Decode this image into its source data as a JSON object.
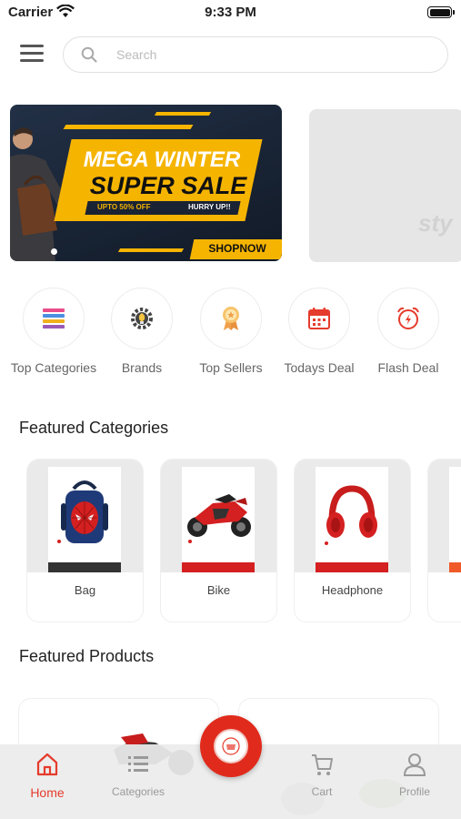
{
  "status_bar": {
    "carrier": "Carrier",
    "time": "9:33 PM"
  },
  "header": {
    "menu_icon": "hamburger-menu-icon",
    "search_icon": "search-icon",
    "search_placeholder": "Search"
  },
  "banner": {
    "line1": "MEGA WINTER",
    "line2": "SUPER SALE",
    "upto": "UPTO 50% OFF",
    "hurry": "HURRY UP!!",
    "cta": "SHOPNOW",
    "second_banner_text": "sty"
  },
  "quick_links": [
    {
      "label": "Top Categories",
      "icon": "stacked-categories-icon"
    },
    {
      "label": "Brands",
      "icon": "gear-brand-icon"
    },
    {
      "label": "Top Sellers",
      "icon": "award-ribbon-icon"
    },
    {
      "label": "Todays Deal",
      "icon": "calendar-icon"
    },
    {
      "label": "Flash Deal",
      "icon": "alarm-clock-icon"
    }
  ],
  "featured_categories": {
    "title": "Featured Categories",
    "items": [
      {
        "name": "Bag",
        "image": "spiderman-backpack-image",
        "bar_color": "#333333"
      },
      {
        "name": "Bike",
        "image": "red-motorcycle-image",
        "bar_color": "#d42020"
      },
      {
        "name": "Headphone",
        "image": "red-headphone-image",
        "bar_color": "#d42020"
      }
    ]
  },
  "featured_products": {
    "title": "Featured Products"
  },
  "bottom_nav": {
    "items": [
      {
        "label": "Home",
        "icon": "home-icon",
        "active": true
      },
      {
        "label": "Categories",
        "icon": "list-icon",
        "active": false
      },
      {
        "label": "Cart",
        "icon": "cart-icon",
        "active": false
      },
      {
        "label": "Profile",
        "icon": "profile-icon",
        "active": false
      }
    ],
    "center_button_icon": "store-logo-icon"
  },
  "colors": {
    "accent": "#e53b2c",
    "banner_yellow": "#f5b400",
    "banner_dark": "#1a2333"
  }
}
